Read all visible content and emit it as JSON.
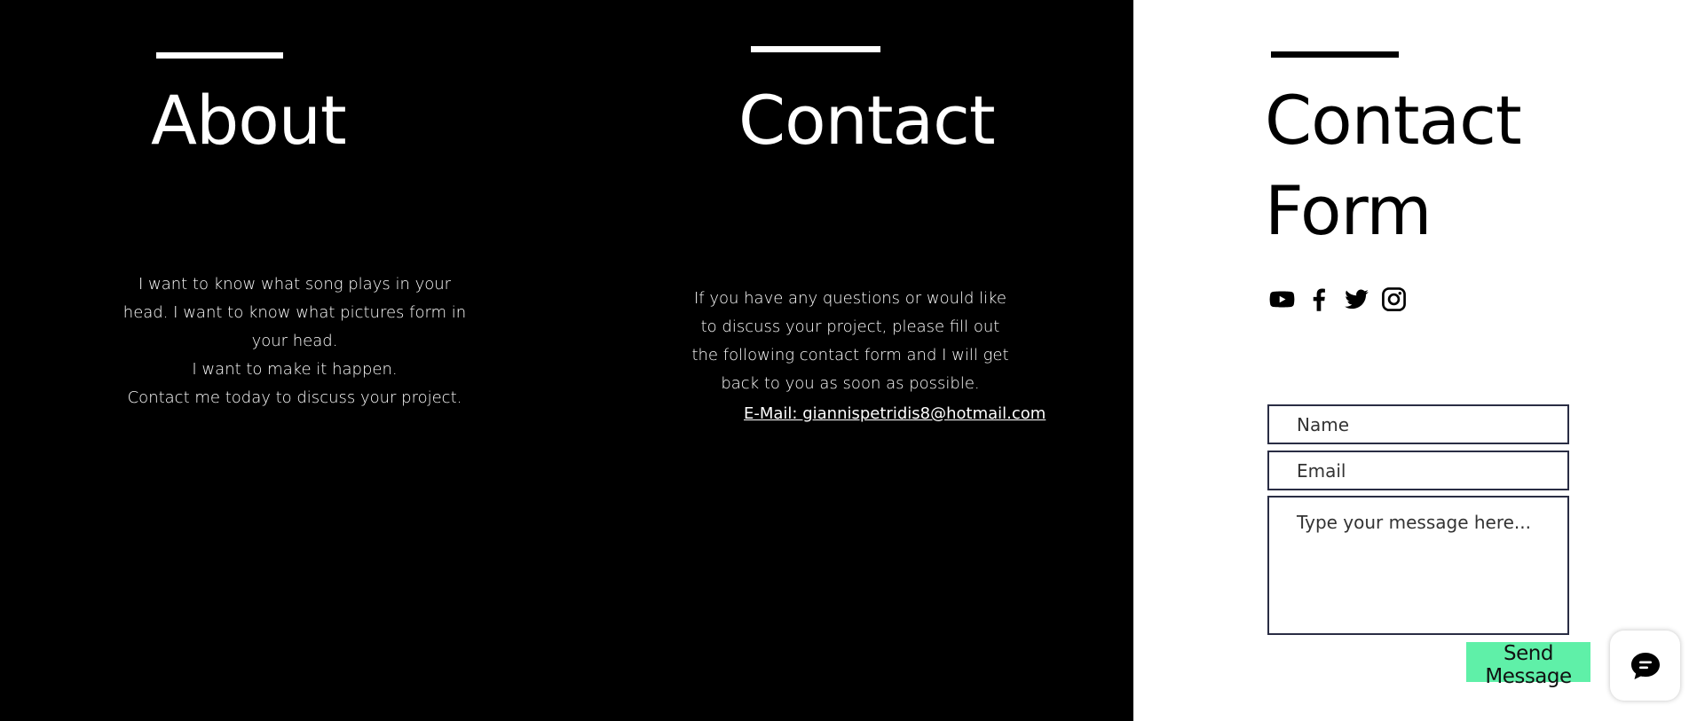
{
  "about": {
    "title": "About",
    "text": "I want to know what song plays in your\nhead. I want to know what pictures form in\nyour head.\nI want to make it happen.\nContact me today to discuss your project."
  },
  "contact": {
    "title": "Contact",
    "text": "If you have any questions or would like\nto discuss your project, please fill out\nthe following contact form and I will get\nback to you as soon as possible.",
    "email_link": "E-Mail: giannispetridis8@hotmail.com"
  },
  "contact_form": {
    "title_line1": "Contact",
    "title_line2": "Form",
    "social_icons": [
      "youtube-icon",
      "facebook-icon",
      "twitter-icon",
      "instagram-icon"
    ],
    "name_placeholder": "Name",
    "email_placeholder": "Email",
    "message_placeholder": "Type your message here...",
    "submit_label": "Send Message"
  },
  "chat": {
    "icon": "chat-bubble-icon"
  },
  "colors": {
    "dark_bg": "#000000",
    "light_bg": "#ffffff",
    "accent": "#5ff0a8",
    "field_border": "#2a2d44"
  }
}
